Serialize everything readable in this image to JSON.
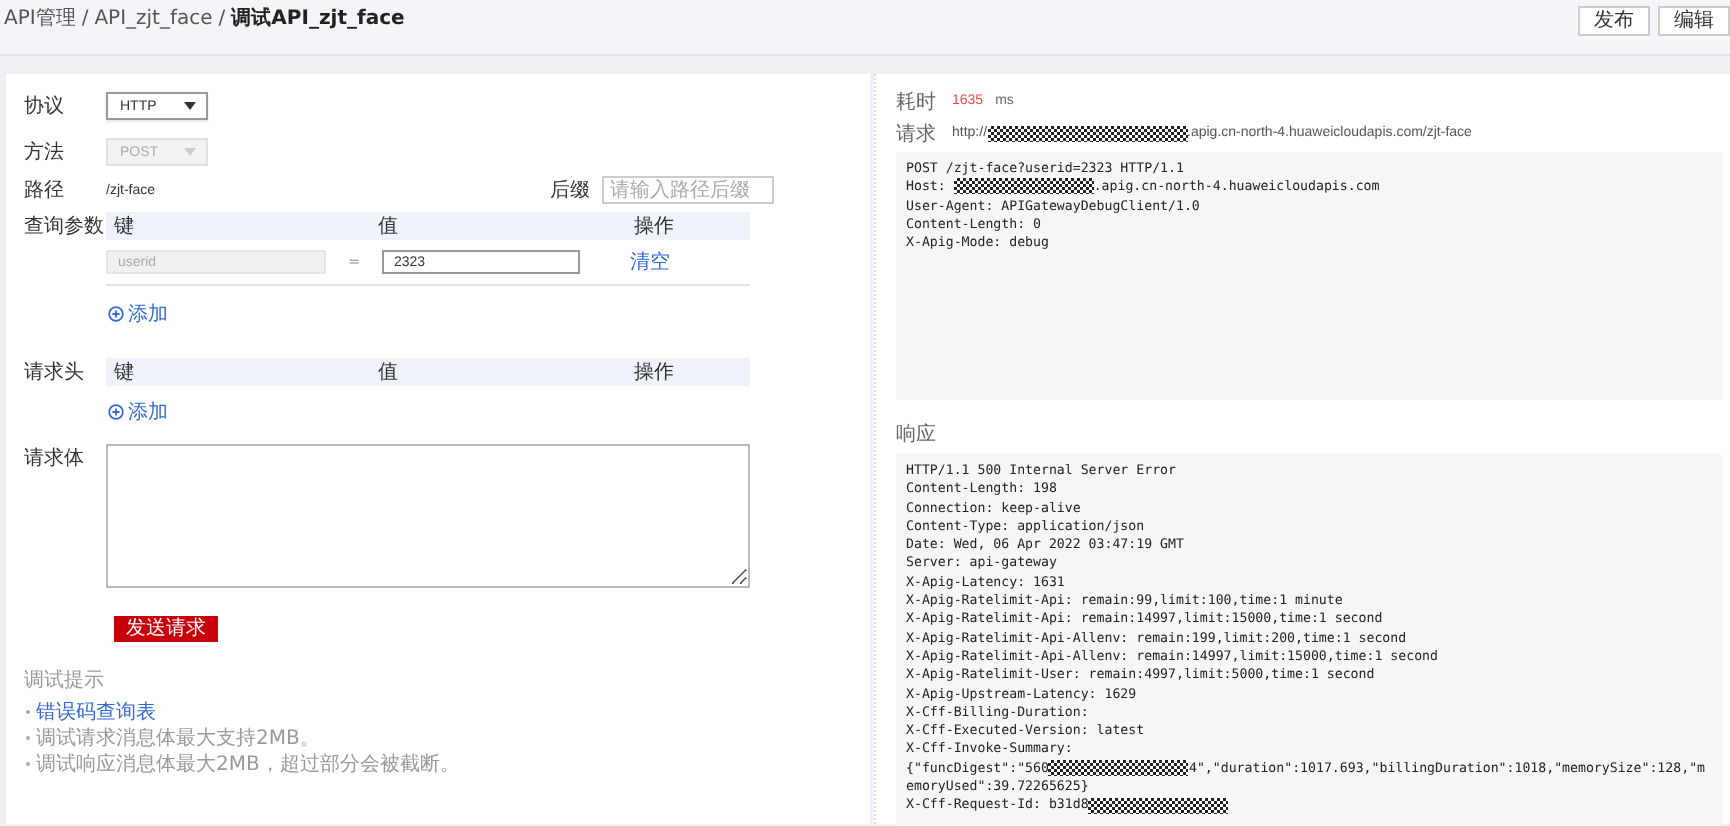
{
  "breadcrumb": [
    {
      "label": "API管理",
      "current": false
    },
    {
      "label": "API_zjt_face",
      "current": false
    },
    {
      "label": "调试API_zjt_face",
      "current": true
    }
  ],
  "breadcrumb_separator": "/",
  "header_buttons": [
    "发布",
    "编辑"
  ],
  "form": {
    "protocol": {
      "label": "协议",
      "value": "HTTP"
    },
    "method": {
      "label": "方法",
      "value": "POST",
      "disabled": true
    },
    "path": {
      "label": "路径",
      "value": "/zjt-face",
      "suffix_label": "后缀",
      "suffix_placeholder": "请输入路径后缀"
    },
    "query_params": {
      "label": "查询参数",
      "columns": [
        "键",
        "值",
        "操作"
      ],
      "rows": [
        {
          "key": "userid",
          "key_disabled": true,
          "equals": "=",
          "value": "2323",
          "action": "清空"
        }
      ],
      "add": "添加"
    },
    "headers": {
      "label": "请求头",
      "columns": [
        "键",
        "值",
        "操作"
      ],
      "add": "添加"
    },
    "body": {
      "label": "请求体"
    },
    "send_button": "发送请求",
    "tips": {
      "title": "调试提示",
      "items": [
        {
          "kind": "link",
          "text": "错误码查询表"
        },
        {
          "kind": "text",
          "text": "调试请求消息体最大支持2MB。"
        },
        {
          "kind": "text",
          "text": "调试响应消息体最大2MB，超过部分会被截断。"
        }
      ]
    }
  },
  "result": {
    "duration_label": "耗时",
    "duration": "1635",
    "duration_unit": "ms",
    "request_label": "请求",
    "request_url": [
      {
        "kind": "text",
        "text": "http://"
      },
      {
        "kind": "redacted"
      },
      {
        "kind": "text",
        "text": ".apig.cn-north-4.huaweicloudapis.com/zjt-face"
      }
    ],
    "request_raw": [
      [
        {
          "kind": "text",
          "text": "POST /zjt-face?userid=2323 HTTP/1.1"
        }
      ],
      [
        {
          "kind": "text",
          "text": "Host: "
        },
        {
          "kind": "redacted"
        },
        {
          "kind": "text",
          "text": ".apig.cn-north-4.huaweicloudapis.com"
        }
      ],
      [
        {
          "kind": "text",
          "text": "User-Agent: APIGatewayDebugClient/1.0"
        }
      ],
      [
        {
          "kind": "text",
          "text": "Content-Length: 0"
        }
      ],
      [
        {
          "kind": "text",
          "text": "X-Apig-Mode: debug"
        }
      ]
    ],
    "response_label": "响应",
    "response_raw": [
      [
        {
          "kind": "text",
          "text": "HTTP/1.1 500 Internal Server Error"
        }
      ],
      [
        {
          "kind": "text",
          "text": "Content-Length: 198"
        }
      ],
      [
        {
          "kind": "text",
          "text": "Connection: keep-alive"
        }
      ],
      [
        {
          "kind": "text",
          "text": "Content-Type: application/json"
        }
      ],
      [
        {
          "kind": "text",
          "text": "Date: Wed, 06 Apr 2022 03:47:19 GMT"
        }
      ],
      [
        {
          "kind": "text",
          "text": "Server: api-gateway"
        }
      ],
      [
        {
          "kind": "text",
          "text": "X-Apig-Latency: 1631"
        }
      ],
      [
        {
          "kind": "text",
          "text": "X-Apig-Ratelimit-Api: remain:99,limit:100,time:1 minute"
        }
      ],
      [
        {
          "kind": "text",
          "text": "X-Apig-Ratelimit-Api: remain:14997,limit:15000,time:1 second"
        }
      ],
      [
        {
          "kind": "text",
          "text": "X-Apig-Ratelimit-Api-Allenv: remain:199,limit:200,time:1 second"
        }
      ],
      [
        {
          "kind": "text",
          "text": "X-Apig-Ratelimit-Api-Allenv: remain:14997,limit:15000,time:1 second"
        }
      ],
      [
        {
          "kind": "text",
          "text": "X-Apig-Ratelimit-User: remain:4997,limit:5000,time:1 second"
        }
      ],
      [
        {
          "kind": "text",
          "text": "X-Apig-Upstream-Latency: 1629"
        }
      ],
      [
        {
          "kind": "text",
          "text": "X-Cff-Billing-Duration:"
        }
      ],
      [
        {
          "kind": "text",
          "text": "X-Cff-Executed-Version: latest"
        }
      ],
      [
        {
          "kind": "text",
          "text": "X-Cff-Invoke-Summary:"
        }
      ],
      [
        {
          "kind": "text",
          "text": "{\"funcDigest\":\"560"
        },
        {
          "kind": "redacted"
        },
        {
          "kind": "text",
          "text": "4\",\"duration\":1017.693,\"billingDuration\":1018,\"memorySize\":128,\"m"
        }
      ],
      [
        {
          "kind": "text",
          "text": "emoryUsed\":39.72265625}"
        }
      ],
      [
        {
          "kind": "text",
          "text": "X-Cff-Request-Id: b31d8"
        },
        {
          "kind": "redacted"
        }
      ]
    ]
  }
}
